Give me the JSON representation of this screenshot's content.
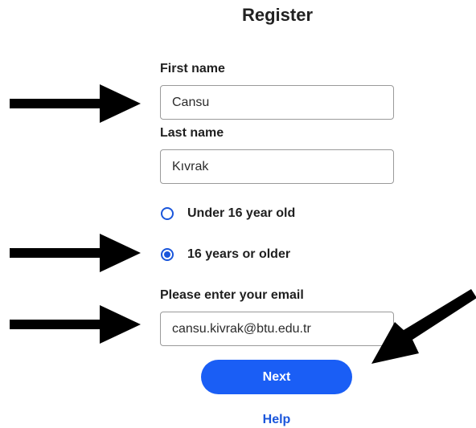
{
  "form": {
    "title": "Register",
    "first_name": {
      "label": "First name",
      "value": "Cansu"
    },
    "last_name": {
      "label": "Last name",
      "value": "Kıvrak"
    },
    "age_options": [
      {
        "label": "Under 16 year old",
        "selected": false
      },
      {
        "label": "16 years or older",
        "selected": true
      }
    ],
    "email": {
      "label": "Please enter your email",
      "value": "cansu.kivrak@btu.edu.tr"
    },
    "next_label": "Next",
    "help_label": "Help"
  },
  "colors": {
    "accent": "#1a5ef5",
    "link": "#1a56db",
    "arrow": "#000000"
  },
  "annotations": [
    {
      "icon": "arrow-right-icon",
      "points_to": "first-name"
    },
    {
      "icon": "arrow-right-icon",
      "points_to": "age-option-16-or-older"
    },
    {
      "icon": "arrow-right-icon",
      "points_to": "email"
    },
    {
      "icon": "arrow-down-left-icon",
      "points_to": "next"
    }
  ]
}
